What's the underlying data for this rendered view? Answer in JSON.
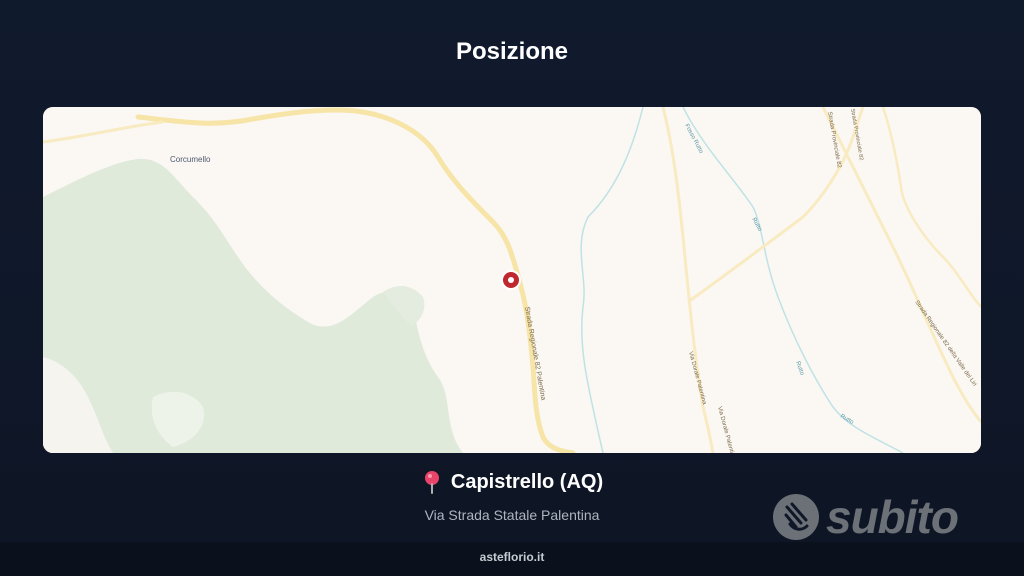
{
  "page": {
    "title": "Posizione"
  },
  "map": {
    "labels": {
      "corcumello": "Corcumello",
      "strada_regionale": "Strada Regionale 82 Palentina",
      "fosso_rutto": "Fosso Rutto",
      "provinciale_top": "Strada Provinciale 82",
      "provinciale_small": "Strada Provinciale 82",
      "valle_roveto": "Strada Regionale 82 della Valle del Liri",
      "via_dorale": "Via Dorale Palentina",
      "via_dorale_2": "Via Dorale Palentina",
      "rutto1": "Rutto",
      "rutto2": "Rutto",
      "rutto3": "Rutto"
    },
    "colors": {
      "forest": "#dfeadb",
      "road": "#f7e4a7",
      "water": "#bfe3e5",
      "marker": "#c0282f"
    }
  },
  "location": {
    "pin_icon": "map-pin-icon",
    "name": "Capistrello (AQ)",
    "address": "Via Strada Statale Palentina"
  },
  "brand": {
    "name": "subito"
  },
  "footer": {
    "text": "asteflorio.it"
  }
}
